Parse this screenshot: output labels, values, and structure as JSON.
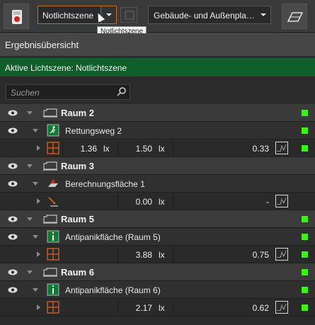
{
  "toolbar": {
    "scene_select_value": "Notlichtszene",
    "tooltip": "Notlichtszene",
    "plan_select_value": "Gebäude- und Außenpla…"
  },
  "panel": {
    "title": "Ergebnisübersicht",
    "active_scene": "Aktive Lichtszene: Notlichtszene",
    "search_placeholder": "Suchen"
  },
  "colors": {
    "status_ok": "#3ef01a",
    "active_bar": "#0e5f2a",
    "accent": "#c0701a"
  },
  "rooms": [
    {
      "name": "Raum 2",
      "object": {
        "name": "Rettungsweg 2",
        "icon": "exit-sign-icon"
      },
      "result": {
        "e1": "1.36",
        "u1": "lx",
        "e2": "1.50",
        "u2": "lx",
        "ratio": "0.33"
      }
    },
    {
      "name": "Raum 3",
      "object": {
        "name": "Berechnungsfläche 1",
        "icon": "calculation-surface-icon"
      },
      "result": {
        "e1": "0.00",
        "u1": "lx",
        "ratio": "-"
      }
    },
    {
      "name": "Raum 5",
      "object": {
        "name": "Antipanikfläche (Raum 5)",
        "icon": "antipanic-icon"
      },
      "result": {
        "e1": "3.88",
        "u1": "lx",
        "ratio": "0.75"
      }
    },
    {
      "name": "Raum 6",
      "object": {
        "name": "Antipanikfläche (Raum 6)",
        "icon": "antipanic-icon"
      },
      "result": {
        "e1": "2.17",
        "u1": "lx",
        "ratio": "0.62"
      }
    }
  ]
}
